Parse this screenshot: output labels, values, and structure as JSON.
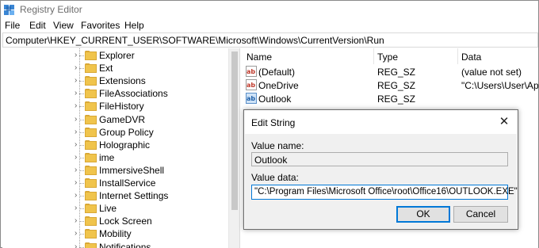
{
  "window": {
    "title": "Registry Editor"
  },
  "menu": [
    "File",
    "Edit",
    "View",
    "Favorites",
    "Help"
  ],
  "address": "Computer\\HKEY_CURRENT_USER\\SOFTWARE\\Microsoft\\Windows\\CurrentVersion\\Run",
  "tree": {
    "items": [
      "Explorer",
      "Ext",
      "Extensions",
      "FileAssociations",
      "FileHistory",
      "GameDVR",
      "Group Policy",
      "Holographic",
      "ime",
      "ImmersiveShell",
      "InstallService",
      "Internet Settings",
      "Live",
      "Lock Screen",
      "Mobility",
      "Notifications"
    ]
  },
  "list": {
    "columns": {
      "name": "Name",
      "type": "Type",
      "data": "Data"
    },
    "rows": [
      {
        "name": "(Default)",
        "type": "REG_SZ",
        "data": "(value not set)",
        "icon": "string-value-icon"
      },
      {
        "name": "OneDrive",
        "type": "REG_SZ",
        "data": "\"C:\\Users\\User\\AppD",
        "icon": "string-value-icon"
      },
      {
        "name": "Outlook",
        "type": "REG_SZ",
        "data": "",
        "icon": "string-value-icon-selected"
      }
    ]
  },
  "dialog": {
    "title": "Edit String",
    "close_glyph": "✕",
    "value_name_label": "Value name:",
    "value_name": "Outlook",
    "value_data_label": "Value data:",
    "value_data": "\"C:\\Program Files\\Microsoft Office\\root\\Office16\\OUTLOOK.EXE\"",
    "ok_label": "OK",
    "cancel_label": "Cancel"
  },
  "colors": {
    "accent": "#0078d7",
    "folder": "#f0c44c",
    "dialog_bg": "#f0f0f0"
  }
}
